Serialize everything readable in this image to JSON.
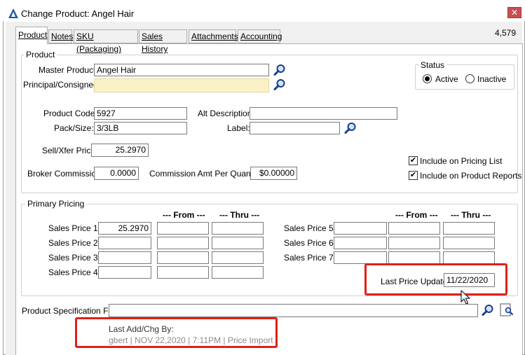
{
  "window": {
    "title": "Change Product: Angel Hair",
    "record_id": "4,579",
    "close_glyph": "✕"
  },
  "tabs": [
    {
      "label": "Product"
    },
    {
      "label": "Notes"
    },
    {
      "label": "SKU (Packaging)"
    },
    {
      "label": "Sales History"
    },
    {
      "label": "Attachments"
    },
    {
      "label": "Accounting"
    }
  ],
  "product_group": {
    "title": "Product",
    "master_product_label": "Master Product:",
    "master_product_value": "Angel Hair",
    "principal_label": "Principal/Consignee:",
    "principal_value": "",
    "product_code_label": "Product Code:",
    "product_code_value": "5927",
    "alt_description_label": "Alt Description:",
    "alt_description_value": "",
    "pack_size_label": "Pack/Size:",
    "pack_size_value": "3/3LB",
    "label_label": "Label:",
    "label_value": "",
    "sell_price_label": "Sell/Xfer Price:",
    "sell_price_value": "25.2970",
    "broker_commission_label": "Broker Commission:",
    "broker_commission_value": "0.0000",
    "commission_amt_label": "Commission Amt Per Quantity:",
    "commission_amt_value": "$0.00000",
    "include_pricing_label": "Include on Pricing List",
    "include_reports_label": "Include on Product Reports",
    "include_pricing_checked": true,
    "include_reports_checked": true
  },
  "status": {
    "title": "Status",
    "active_label": "Active",
    "inactive_label": "Inactive",
    "selected": "Active"
  },
  "pricing": {
    "title": "Primary Pricing",
    "from_header": "--- From ---",
    "thru_header": "--- Thru ---",
    "left_rows": [
      {
        "label": "Sales Price 1:",
        "price": "25.2970",
        "from": "",
        "thru": ""
      },
      {
        "label": "Sales Price 2:",
        "price": "",
        "from": "",
        "thru": ""
      },
      {
        "label": "Sales Price 3:",
        "price": "",
        "from": "",
        "thru": ""
      },
      {
        "label": "Sales Price 4:",
        "price": "",
        "from": "",
        "thru": ""
      }
    ],
    "right_rows": [
      {
        "label": "Sales Price 5:",
        "price": "",
        "from": "",
        "thru": ""
      },
      {
        "label": "Sales Price 6:",
        "price": "",
        "from": "",
        "thru": ""
      },
      {
        "label": "Sales Price 7:",
        "price": "",
        "from": "",
        "thru": ""
      }
    ],
    "last_price_update_label": "Last Price Update:",
    "last_price_update_value": "11/22/2020"
  },
  "spec_file": {
    "label": "Product Specification File:",
    "value": ""
  },
  "audit": {
    "label": "Last Add/Chg By:",
    "value": "gbert | NOV 22,2020 |  7:11PM | Price Import"
  },
  "colors": {
    "highlight": "#e0201b",
    "principal_field": "#fbf1c7",
    "accent": "#1e5aa8"
  }
}
